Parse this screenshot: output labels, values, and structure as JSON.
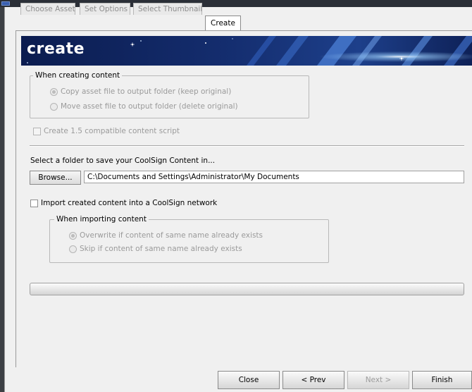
{
  "tabs": [
    {
      "label": "Choose Asset",
      "active": false
    },
    {
      "label": "Set Options",
      "active": false
    },
    {
      "label": "Select Thumbnail",
      "active": false
    },
    {
      "label": "Create",
      "active": true
    }
  ],
  "banner": {
    "title": "create"
  },
  "creating_group": {
    "label": "When creating content",
    "options": [
      {
        "label": "Copy asset file to output folder (keep original)",
        "selected": true
      },
      {
        "label": "Move asset file to output folder (delete original)",
        "selected": false
      }
    ]
  },
  "compat_checkbox": {
    "label": "Create 1.5 compatible content script",
    "checked": false
  },
  "save_folder": {
    "prompt": "Select a folder to save your CoolSign Content in...",
    "browse_label": "Browse...",
    "path": "C:\\Documents and Settings\\Administrator\\My Documents"
  },
  "import_checkbox": {
    "label": "Import created content into a CoolSign network",
    "checked": false
  },
  "importing_group": {
    "label": "When importing content",
    "options": [
      {
        "label": "Overwrite if content of same name already exists",
        "selected": true
      },
      {
        "label": "Skip if content of same name already exists",
        "selected": false
      }
    ]
  },
  "progress": {
    "value": 0
  },
  "footer": {
    "close_label": "Close",
    "prev_label": "< Prev",
    "next_label": "Next >",
    "finish_label": "Finish"
  },
  "colors": {
    "banner_dark": "#0b1c4f",
    "banner_mid": "#2a4f9c",
    "banner_light": "#d8ecff"
  }
}
